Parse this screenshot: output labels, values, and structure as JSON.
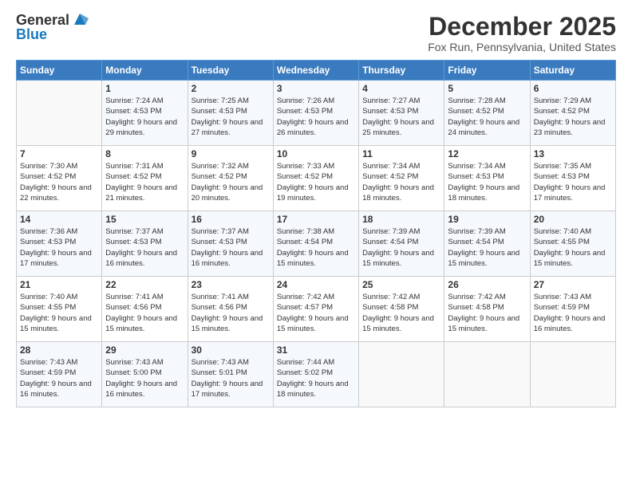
{
  "logo": {
    "line1": "General",
    "line2": "Blue"
  },
  "title": "December 2025",
  "location": "Fox Run, Pennsylvania, United States",
  "weekdays": [
    "Sunday",
    "Monday",
    "Tuesday",
    "Wednesday",
    "Thursday",
    "Friday",
    "Saturday"
  ],
  "weeks": [
    [
      {
        "day": "",
        "sunrise": "",
        "sunset": "",
        "daylight": ""
      },
      {
        "day": "1",
        "sunrise": "Sunrise: 7:24 AM",
        "sunset": "Sunset: 4:53 PM",
        "daylight": "Daylight: 9 hours and 29 minutes."
      },
      {
        "day": "2",
        "sunrise": "Sunrise: 7:25 AM",
        "sunset": "Sunset: 4:53 PM",
        "daylight": "Daylight: 9 hours and 27 minutes."
      },
      {
        "day": "3",
        "sunrise": "Sunrise: 7:26 AM",
        "sunset": "Sunset: 4:53 PM",
        "daylight": "Daylight: 9 hours and 26 minutes."
      },
      {
        "day": "4",
        "sunrise": "Sunrise: 7:27 AM",
        "sunset": "Sunset: 4:53 PM",
        "daylight": "Daylight: 9 hours and 25 minutes."
      },
      {
        "day": "5",
        "sunrise": "Sunrise: 7:28 AM",
        "sunset": "Sunset: 4:52 PM",
        "daylight": "Daylight: 9 hours and 24 minutes."
      },
      {
        "day": "6",
        "sunrise": "Sunrise: 7:29 AM",
        "sunset": "Sunset: 4:52 PM",
        "daylight": "Daylight: 9 hours and 23 minutes."
      }
    ],
    [
      {
        "day": "7",
        "sunrise": "Sunrise: 7:30 AM",
        "sunset": "Sunset: 4:52 PM",
        "daylight": "Daylight: 9 hours and 22 minutes."
      },
      {
        "day": "8",
        "sunrise": "Sunrise: 7:31 AM",
        "sunset": "Sunset: 4:52 PM",
        "daylight": "Daylight: 9 hours and 21 minutes."
      },
      {
        "day": "9",
        "sunrise": "Sunrise: 7:32 AM",
        "sunset": "Sunset: 4:52 PM",
        "daylight": "Daylight: 9 hours and 20 minutes."
      },
      {
        "day": "10",
        "sunrise": "Sunrise: 7:33 AM",
        "sunset": "Sunset: 4:52 PM",
        "daylight": "Daylight: 9 hours and 19 minutes."
      },
      {
        "day": "11",
        "sunrise": "Sunrise: 7:34 AM",
        "sunset": "Sunset: 4:52 PM",
        "daylight": "Daylight: 9 hours and 18 minutes."
      },
      {
        "day": "12",
        "sunrise": "Sunrise: 7:34 AM",
        "sunset": "Sunset: 4:53 PM",
        "daylight": "Daylight: 9 hours and 18 minutes."
      },
      {
        "day": "13",
        "sunrise": "Sunrise: 7:35 AM",
        "sunset": "Sunset: 4:53 PM",
        "daylight": "Daylight: 9 hours and 17 minutes."
      }
    ],
    [
      {
        "day": "14",
        "sunrise": "Sunrise: 7:36 AM",
        "sunset": "Sunset: 4:53 PM",
        "daylight": "Daylight: 9 hours and 17 minutes."
      },
      {
        "day": "15",
        "sunrise": "Sunrise: 7:37 AM",
        "sunset": "Sunset: 4:53 PM",
        "daylight": "Daylight: 9 hours and 16 minutes."
      },
      {
        "day": "16",
        "sunrise": "Sunrise: 7:37 AM",
        "sunset": "Sunset: 4:53 PM",
        "daylight": "Daylight: 9 hours and 16 minutes."
      },
      {
        "day": "17",
        "sunrise": "Sunrise: 7:38 AM",
        "sunset": "Sunset: 4:54 PM",
        "daylight": "Daylight: 9 hours and 15 minutes."
      },
      {
        "day": "18",
        "sunrise": "Sunrise: 7:39 AM",
        "sunset": "Sunset: 4:54 PM",
        "daylight": "Daylight: 9 hours and 15 minutes."
      },
      {
        "day": "19",
        "sunrise": "Sunrise: 7:39 AM",
        "sunset": "Sunset: 4:54 PM",
        "daylight": "Daylight: 9 hours and 15 minutes."
      },
      {
        "day": "20",
        "sunrise": "Sunrise: 7:40 AM",
        "sunset": "Sunset: 4:55 PM",
        "daylight": "Daylight: 9 hours and 15 minutes."
      }
    ],
    [
      {
        "day": "21",
        "sunrise": "Sunrise: 7:40 AM",
        "sunset": "Sunset: 4:55 PM",
        "daylight": "Daylight: 9 hours and 15 minutes."
      },
      {
        "day": "22",
        "sunrise": "Sunrise: 7:41 AM",
        "sunset": "Sunset: 4:56 PM",
        "daylight": "Daylight: 9 hours and 15 minutes."
      },
      {
        "day": "23",
        "sunrise": "Sunrise: 7:41 AM",
        "sunset": "Sunset: 4:56 PM",
        "daylight": "Daylight: 9 hours and 15 minutes."
      },
      {
        "day": "24",
        "sunrise": "Sunrise: 7:42 AM",
        "sunset": "Sunset: 4:57 PM",
        "daylight": "Daylight: 9 hours and 15 minutes."
      },
      {
        "day": "25",
        "sunrise": "Sunrise: 7:42 AM",
        "sunset": "Sunset: 4:58 PM",
        "daylight": "Daylight: 9 hours and 15 minutes."
      },
      {
        "day": "26",
        "sunrise": "Sunrise: 7:42 AM",
        "sunset": "Sunset: 4:58 PM",
        "daylight": "Daylight: 9 hours and 15 minutes."
      },
      {
        "day": "27",
        "sunrise": "Sunrise: 7:43 AM",
        "sunset": "Sunset: 4:59 PM",
        "daylight": "Daylight: 9 hours and 16 minutes."
      }
    ],
    [
      {
        "day": "28",
        "sunrise": "Sunrise: 7:43 AM",
        "sunset": "Sunset: 4:59 PM",
        "daylight": "Daylight: 9 hours and 16 minutes."
      },
      {
        "day": "29",
        "sunrise": "Sunrise: 7:43 AM",
        "sunset": "Sunset: 5:00 PM",
        "daylight": "Daylight: 9 hours and 16 minutes."
      },
      {
        "day": "30",
        "sunrise": "Sunrise: 7:43 AM",
        "sunset": "Sunset: 5:01 PM",
        "daylight": "Daylight: 9 hours and 17 minutes."
      },
      {
        "day": "31",
        "sunrise": "Sunrise: 7:44 AM",
        "sunset": "Sunset: 5:02 PM",
        "daylight": "Daylight: 9 hours and 18 minutes."
      },
      {
        "day": "",
        "sunrise": "",
        "sunset": "",
        "daylight": ""
      },
      {
        "day": "",
        "sunrise": "",
        "sunset": "",
        "daylight": ""
      },
      {
        "day": "",
        "sunrise": "",
        "sunset": "",
        "daylight": ""
      }
    ]
  ]
}
